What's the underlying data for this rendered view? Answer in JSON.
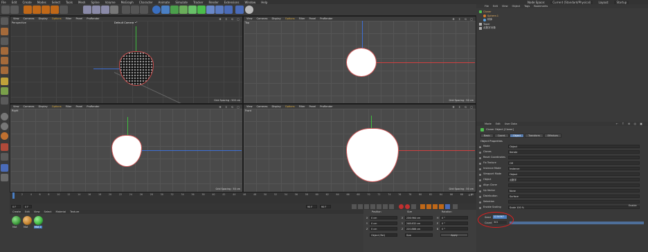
{
  "menu": [
    "File",
    "Edit",
    "Create",
    "Modes",
    "Select",
    "Tools",
    "Mesh",
    "Spline",
    "Volume",
    "MoGraph",
    "Character",
    "Animate",
    "Simulate",
    "Tracker",
    "Render",
    "Extensions",
    "Window",
    "Help"
  ],
  "right_menu": {
    "node_space_label": "Node Space:",
    "node_space_value": "Current (Standard/Physical)",
    "layout_label": "Layout:",
    "layout_value": "Startup"
  },
  "viewport_menu": [
    "View",
    "Cameras",
    "Display",
    "Options",
    "Filter",
    "Panel",
    "ProRender"
  ],
  "viewports": {
    "perspective": {
      "name": "Perspective",
      "camera": "Default Camera •°",
      "grid": "Grid Spacing : 500 cm"
    },
    "top": {
      "name": "Top",
      "grid": "Grid Spacing : 50 cm"
    },
    "right": {
      "name": "Right",
      "grid": "Grid Spacing : 50 cm"
    },
    "front": {
      "name": "Front",
      "grid": "Grid Spacing : 50 cm"
    }
  },
  "timeline": {
    "ticks": [
      "0",
      "2",
      "4",
      "6",
      "8",
      "10",
      "12",
      "14",
      "16",
      "18",
      "20",
      "22",
      "24",
      "26",
      "28",
      "30",
      "32",
      "34",
      "36",
      "38",
      "40",
      "42",
      "44",
      "46",
      "48",
      "50",
      "52",
      "54",
      "56",
      "58",
      "60",
      "62",
      "64",
      "66",
      "68",
      "70",
      "72",
      "74",
      "76",
      "78",
      "80",
      "82",
      "84",
      "86",
      "88",
      "90"
    ],
    "current_frame": "0 F",
    "start": "0 F",
    "end": "90 F",
    "end2": "90 F",
    "frame_field": "0 F"
  },
  "material_menu": [
    "Create",
    "Edit",
    "View",
    "Select",
    "Material",
    "Texture"
  ],
  "materials": [
    {
      "name": "Mat",
      "color": "#3d9a3a"
    },
    {
      "name": "Mat",
      "color": "#c2802b"
    },
    {
      "name": "Mat.1",
      "color": "#3db63d"
    }
  ],
  "coords": {
    "headers": [
      "Position",
      "Size",
      "Rotation"
    ],
    "rows": [
      {
        "axis": "X",
        "pos": "0 cm",
        "size_axis": "X",
        "size": "236.964 cm",
        "rot_axis": "H",
        "rot": "0 °"
      },
      {
        "axis": "Y",
        "pos": "0 cm",
        "size_axis": "Y",
        "size": "248.632 cm",
        "rot_axis": "P",
        "rot": "0 °"
      },
      {
        "axis": "Z",
        "pos": "0 cm",
        "size_axis": "Z",
        "size": "220.886 cm",
        "rot_axis": "B",
        "rot": "0 °"
      }
    ],
    "mode": "Object (Rel)",
    "size_mode": "Size",
    "apply": "Apply"
  },
  "object_manager": {
    "menu": [
      "File",
      "Edit",
      "View",
      "Object",
      "Tags",
      "Bookmarks"
    ],
    "items": [
      {
        "name": "Cloner",
        "indent": 0,
        "color": "#4ec04e"
      },
      {
        "name": "Sphere.1",
        "indent": 1,
        "color": "#d87b2c"
      },
      {
        "name": "球体",
        "indent": 1,
        "color": "#5aa0e0"
      },
      {
        "name": "Taper",
        "indent": 0,
        "color": "#b0b0b0"
      },
      {
        "name": "点数字对象",
        "indent": 0,
        "color": "#b0b0b0"
      }
    ]
  },
  "attributes": {
    "menu": [
      "Mode",
      "Edit",
      "User Data"
    ],
    "title": "Cloner Object [Cloner]",
    "tabs": [
      "Basic",
      "Coord.",
      "Object",
      "Transform",
      "Effectors"
    ],
    "active_tab": "Object",
    "section": "Object Properties",
    "rows": [
      {
        "label": "Mode",
        "value": "Object"
      },
      {
        "label": "Clones",
        "value": "Iterate"
      },
      {
        "label": "Reset Coordinates",
        "value": ""
      },
      {
        "label": "Fix Texture",
        "value": "Off"
      },
      {
        "label": "Instance Mode",
        "value": "Instance"
      },
      {
        "label": "Viewport Mode",
        "value": "Object"
      },
      {
        "label": "Object",
        "value": "点数字"
      },
      {
        "label": "Align Clone",
        "value": ""
      },
      {
        "label": "Up Vector",
        "value": "None"
      },
      {
        "label": "Distribution",
        "value": "Surface"
      },
      {
        "label": "Selection",
        "value": ""
      },
      {
        "label": "Enable Scaling",
        "value": "Scale  100 %"
      }
    ],
    "enable_label": "Enable",
    "seed_label": "Seed",
    "seed_value": "1234567",
    "count_label": "Count",
    "count_value": "341"
  }
}
